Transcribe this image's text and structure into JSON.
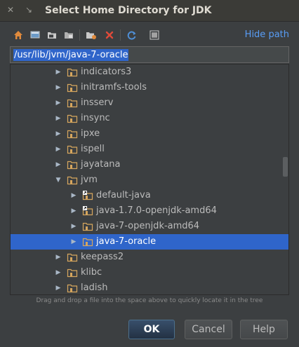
{
  "window": {
    "title": "Select Home Directory for JDK",
    "close_glyph": "✕",
    "minimize_glyph": "↘"
  },
  "toolbar": {
    "buttons": [
      {
        "name": "home-icon",
        "color": "#e08a3c"
      },
      {
        "name": "desktop-icon",
        "color": "#6c9ac7"
      },
      {
        "name": "project-folder-icon",
        "color": "#c9c9c9"
      },
      {
        "name": "module-folder-icon",
        "color": "#c9c9c9"
      },
      {
        "name": "new-folder-icon",
        "color": "#e08a3c"
      },
      {
        "name": "delete-icon",
        "color": "#e04a3a"
      },
      {
        "name": "refresh-icon",
        "color": "#4f8fd6"
      },
      {
        "name": "show-hidden-icon",
        "color": "#c9c9c9"
      }
    ],
    "hide_path_label": "Hide path"
  },
  "path_field": {
    "value": "/usr/lib/jvm/java-7-oracle"
  },
  "tree": {
    "rows": [
      {
        "label": "indicators3",
        "depth": 0,
        "expanded": false,
        "link": false,
        "selected": false
      },
      {
        "label": "initramfs-tools",
        "depth": 0,
        "expanded": false,
        "link": false,
        "selected": false
      },
      {
        "label": "insserv",
        "depth": 0,
        "expanded": false,
        "link": false,
        "selected": false
      },
      {
        "label": "insync",
        "depth": 0,
        "expanded": false,
        "link": false,
        "selected": false
      },
      {
        "label": "ipxe",
        "depth": 0,
        "expanded": false,
        "link": false,
        "selected": false
      },
      {
        "label": "ispell",
        "depth": 0,
        "expanded": false,
        "link": false,
        "selected": false
      },
      {
        "label": "jayatana",
        "depth": 0,
        "expanded": false,
        "link": false,
        "selected": false
      },
      {
        "label": "jvm",
        "depth": 0,
        "expanded": true,
        "link": false,
        "selected": false
      },
      {
        "label": "default-java",
        "depth": 1,
        "expanded": false,
        "link": true,
        "selected": false
      },
      {
        "label": "java-1.7.0-openjdk-amd64",
        "depth": 1,
        "expanded": false,
        "link": true,
        "selected": false
      },
      {
        "label": "java-7-openjdk-amd64",
        "depth": 1,
        "expanded": false,
        "link": false,
        "selected": false
      },
      {
        "label": "java-7-oracle",
        "depth": 1,
        "expanded": false,
        "link": false,
        "selected": true
      },
      {
        "label": "keepass2",
        "depth": 0,
        "expanded": false,
        "link": false,
        "selected": false
      },
      {
        "label": "klibc",
        "depth": 0,
        "expanded": false,
        "link": false,
        "selected": false
      },
      {
        "label": "ladish",
        "depth": 0,
        "expanded": false,
        "link": false,
        "selected": false
      }
    ]
  },
  "hint": "Drag and drop a file into the space above to quickly locate it in the tree",
  "buttons": {
    "ok": "OK",
    "cancel": "Cancel",
    "help": "Help"
  },
  "colors": {
    "accent": "#589df6",
    "selection": "#2f65ca",
    "folder": "#d6a65e"
  }
}
